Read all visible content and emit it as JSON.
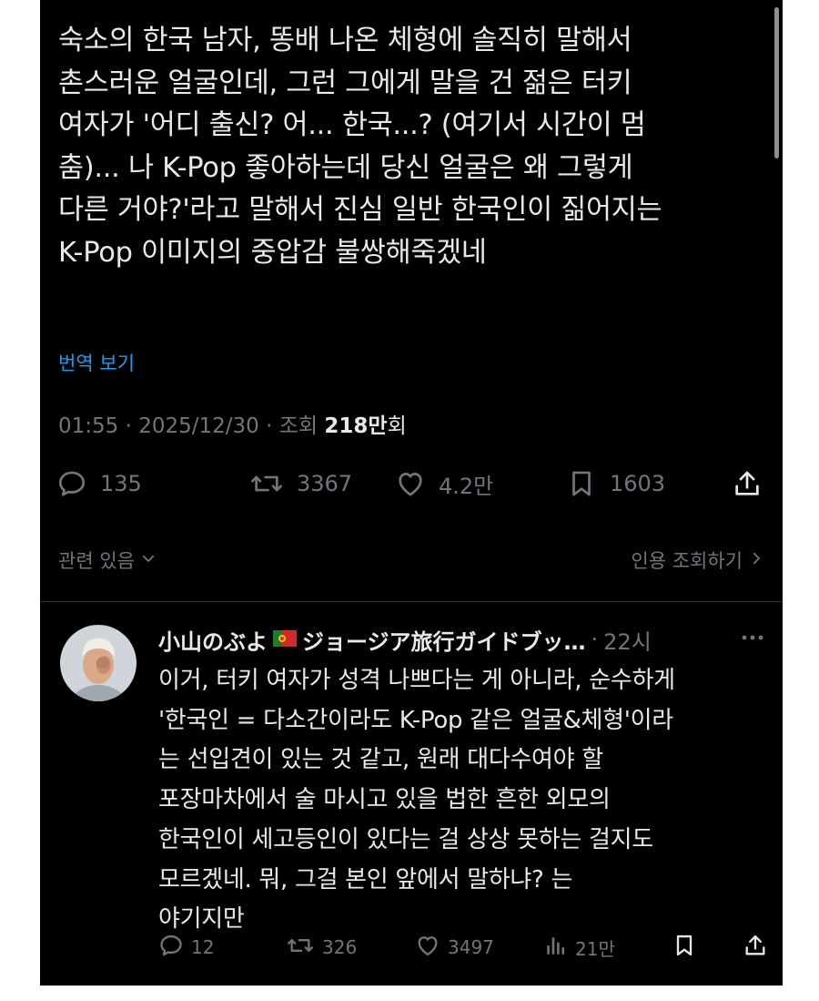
{
  "post": {
    "text": "숙소의 한국 남자, 똥배 나온 체형에 솔직히 말해서\n촌스러운 얼굴인데, 그런 그에게 말을 건 젊은 터키\n여자가 '어디 출신? 어... 한국...? (여기서 시간이 멈\n춤)... 나 K-Pop 좋아하는데 당신 얼굴은 왜 그렇게\n다른 거야?'라고 말해서 진심 일반 한국인이 짊어지는\nK-Pop 이미지의 중압감 불쌍해죽겠네",
    "translate_label": "번역 보기",
    "time": "01:55",
    "date": "2025/12/30",
    "separator": "·",
    "views_label": "조회",
    "views_count": "218만",
    "views_unit": "회",
    "actions": {
      "replies": "135",
      "reposts": "3367",
      "likes": "4.2만",
      "bookmarks": "1603"
    },
    "related_label": "관련 있음",
    "quote_views_label": "인용 조회하기"
  },
  "reply": {
    "name": "小山のぶよ",
    "handle": "ジョージア旅行ガイドブッ…",
    "separator": "·",
    "time": "22시",
    "text": "이거, 터키 여자가 성격 나쁘다는 게 아니라, 순수하게\n'한국인 = 다소간이라도 K-Pop 같은 얼굴&체형'이라\n는 선입견이 있는 것 같고, 원래 대다수여야 할\n포장마차에서 술 마시고 있을 법한 흔한 외모의\n한국인이 세고등인이 있다는 걸 상상 못하는 걸지도\n모르겠네.  뭐, 그걸 본인 앞에서 말하냐? 는\n야기지만",
    "actions": {
      "replies": "12",
      "reposts": "326",
      "likes": "3497",
      "views": "21만"
    }
  },
  "icons": {
    "reply": "speech-bubble-icon",
    "repost": "repost-arrows-icon",
    "like": "heart-icon",
    "bookmark": "bookmark-icon",
    "share": "share-upload-icon",
    "views": "bar-chart-icon",
    "more": "more-dots-icon",
    "chevron_down": "chevron-down-icon",
    "chevron_right": "chevron-right-icon",
    "flag": "portugal-flag-icon"
  },
  "colors": {
    "background": "#000000",
    "text": "#e7e9ea",
    "muted": "#71767b",
    "link": "#1d9bf0",
    "divider": "#2f3336"
  }
}
